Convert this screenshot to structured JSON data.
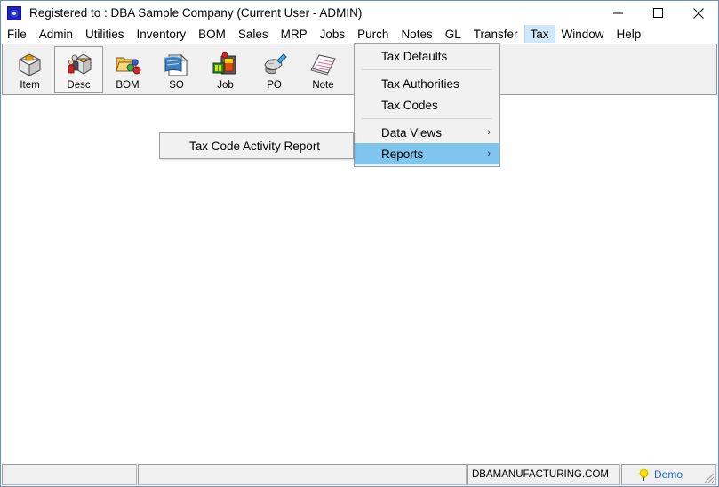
{
  "window": {
    "title": "Registered to : DBA Sample Company (Current User - ADMIN)",
    "icon": "app-icon",
    "controls": {
      "minimize": "minimize-icon",
      "maximize": "maximize-icon",
      "close": "close-icon"
    }
  },
  "menubar": {
    "items": [
      {
        "label": "File",
        "active": false
      },
      {
        "label": "Admin",
        "active": false
      },
      {
        "label": "Utilities",
        "active": false
      },
      {
        "label": "Inventory",
        "active": false
      },
      {
        "label": "BOM",
        "active": false
      },
      {
        "label": "Sales",
        "active": false
      },
      {
        "label": "MRP",
        "active": false
      },
      {
        "label": "Jobs",
        "active": false
      },
      {
        "label": "Purch",
        "active": false
      },
      {
        "label": "Notes",
        "active": false
      },
      {
        "label": "GL",
        "active": false
      },
      {
        "label": "Transfer",
        "active": false
      },
      {
        "label": "Tax",
        "active": true
      },
      {
        "label": "Window",
        "active": false
      },
      {
        "label": "Help",
        "active": false
      }
    ]
  },
  "toolbar": {
    "buttons": [
      {
        "label": "Item",
        "icon": "box-icon",
        "selected": false
      },
      {
        "label": "Desc",
        "icon": "person-box-icon",
        "selected": true
      },
      {
        "label": "BOM",
        "icon": "folder-parts-icon",
        "selected": false
      },
      {
        "label": "SO",
        "icon": "sales-order-icon",
        "selected": false
      },
      {
        "label": "Job",
        "icon": "job-machine-icon",
        "selected": false
      },
      {
        "label": "PO",
        "icon": "purchase-order-icon",
        "selected": false
      },
      {
        "label": "Note",
        "icon": "notepad-icon",
        "selected": false
      }
    ]
  },
  "tax_menu": {
    "items": [
      {
        "label": "Tax Defaults",
        "submenu": false,
        "highlight": false
      },
      {
        "separator": true
      },
      {
        "label": "Tax Authorities",
        "submenu": false,
        "highlight": false
      },
      {
        "label": "Tax Codes",
        "submenu": false,
        "highlight": false
      },
      {
        "separator": true
      },
      {
        "label": "Data Views",
        "submenu": true,
        "highlight": false,
        "arrow": "›"
      },
      {
        "label": "Reports",
        "submenu": true,
        "highlight": true,
        "arrow": "›"
      }
    ]
  },
  "reports_submenu": {
    "items": [
      {
        "label": "Tax Code Activity Report",
        "highlight": false
      }
    ]
  },
  "statusbar": {
    "panel1": "",
    "panel2": "",
    "panel3": "DBAMANUFACTURING.COM",
    "demo_label": "Demo",
    "demo_icon": "lightbulb-icon",
    "resize_grip": "resize-grip-icon"
  },
  "colors": {
    "menu_active_bg": "#cfe8fa",
    "menu_highlight_bg": "#7ec6ef",
    "window_border": "#6a8fc0",
    "toolbar_bg": "#f0f0f0",
    "demo_text": "#1b63c8",
    "client_bg": "#ffffff"
  }
}
